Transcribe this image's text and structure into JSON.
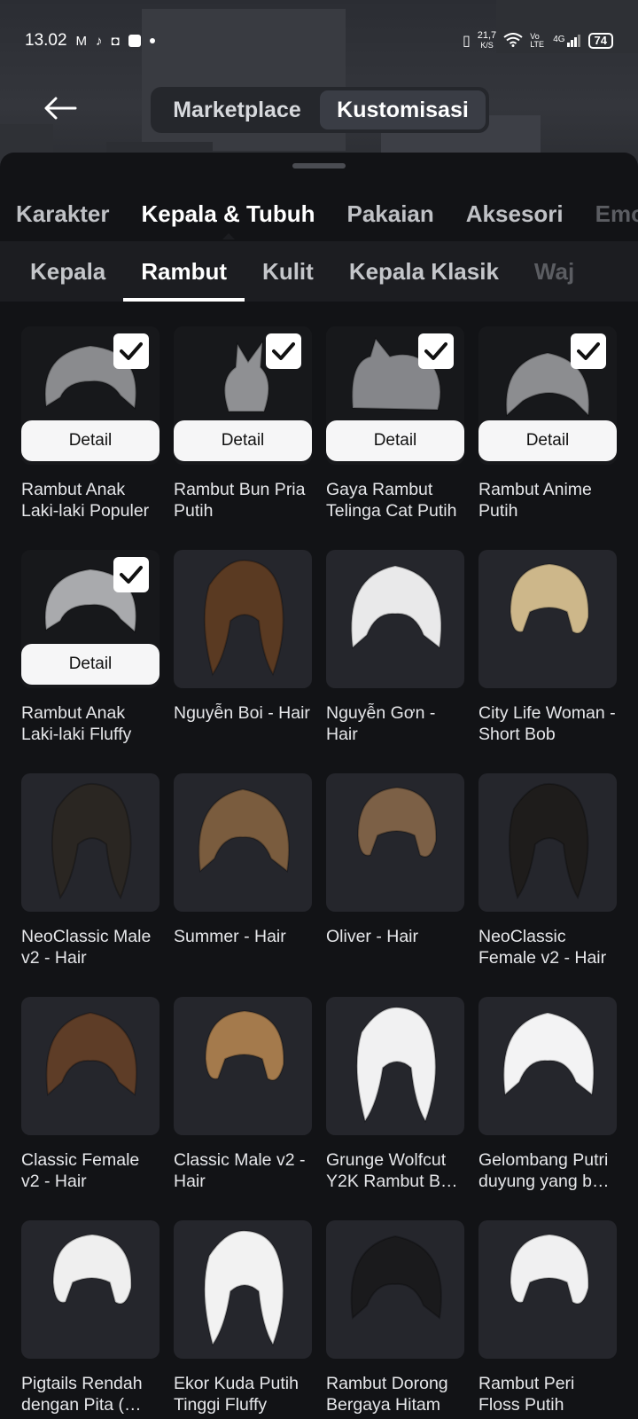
{
  "status": {
    "time": "13.02",
    "net_speed": "21,7",
    "net_unit": "K/S",
    "volte": "Vo LTE",
    "signal": "4G",
    "battery": "74"
  },
  "header": {
    "tabs": [
      {
        "label": "Marketplace",
        "active": false
      },
      {
        "label": "Kustomisasi",
        "active": true
      }
    ]
  },
  "category_tabs": [
    "Karakter",
    "Kepala & Tubuh",
    "Pakaian",
    "Aksesori",
    "Emo"
  ],
  "category_active": "Kepala & Tubuh",
  "subcategory_tabs": [
    "Kepala",
    "Rambut",
    "Kulit",
    "Kepala Klasik",
    "Waj"
  ],
  "subcategory_active": "Rambut",
  "detail_label": "Detail",
  "items": [
    {
      "name": "Rambut Anak Laki-laki Populer",
      "equipped": true,
      "color": "#8a8b8e"
    },
    {
      "name": "Rambut Bun Pria Putih",
      "equipped": true,
      "color": "#8f9093"
    },
    {
      "name": "Gaya Rambut Telinga Cat Putih",
      "equipped": true,
      "color": "#85868a"
    },
    {
      "name": "Rambut Anime Putih",
      "equipped": true,
      "color": "#8c8d90"
    },
    {
      "name": "Rambut Anak Laki-laki Fluffy",
      "equipped": true,
      "color": "#a9aaad"
    },
    {
      "name": "Nguyễn Boi - Hair",
      "equipped": false,
      "color": "#5a3a22"
    },
    {
      "name": "Nguyễn Gơn - Hair",
      "equipped": false,
      "color": "#e9e9ea"
    },
    {
      "name": "City Life Woman - Short Bob",
      "equipped": false,
      "color": "#cdb78a"
    },
    {
      "name": "NeoClassic Male v2 - Hair",
      "equipped": false,
      "color": "#2a2622"
    },
    {
      "name": "Summer - Hair",
      "equipped": false,
      "color": "#7a5c3e"
    },
    {
      "name": "Oliver - Hair",
      "equipped": false,
      "color": "#7c6046"
    },
    {
      "name": "NeoClassic Female v2 - Hair",
      "equipped": false,
      "color": "#1e1c1b"
    },
    {
      "name": "Classic Female v2 - Hair",
      "equipped": false,
      "color": "#5e3d27"
    },
    {
      "name": "Classic Male v2 - Hair",
      "equipped": false,
      "color": "#a47a4c"
    },
    {
      "name": "Grunge Wolfcut Y2K Rambut B…",
      "equipped": false,
      "color": "#f1f1f2"
    },
    {
      "name": "Gelombang Putri duyung yang b…",
      "equipped": false,
      "color": "#f3f3f4"
    },
    {
      "name": "Pigtails Rendah dengan Pita (…",
      "equipped": false,
      "color": "#efefef"
    },
    {
      "name": "Ekor Kuda Putih Tinggi Fluffy",
      "equipped": false,
      "color": "#f2f2f2"
    },
    {
      "name": "Rambut Dorong Bergaya Hitam",
      "equipped": false,
      "color": "#1a1a1c"
    },
    {
      "name": "Rambut Peri Floss Putih",
      "equipped": false,
      "color": "#f0f0f1"
    }
  ]
}
